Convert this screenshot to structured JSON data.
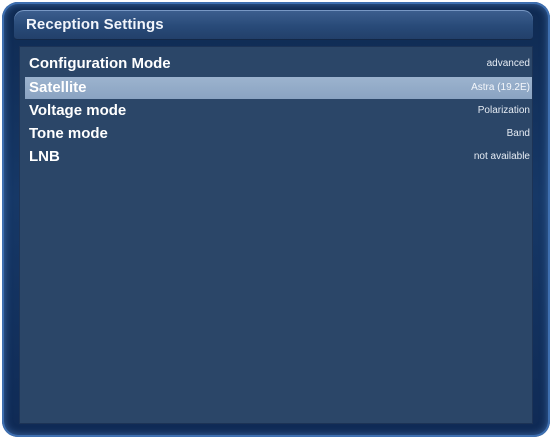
{
  "window": {
    "title": "Reception Settings"
  },
  "settings": [
    {
      "label": "Configuration Mode",
      "value": "advanced"
    },
    {
      "label": "Satellite",
      "value": "Astra (19.2E)"
    },
    {
      "label": "Voltage mode",
      "value": "Polarization"
    },
    {
      "label": "Tone mode",
      "value": "Band"
    },
    {
      "label": "LNB",
      "value": "not available"
    }
  ],
  "selected_index": 1
}
